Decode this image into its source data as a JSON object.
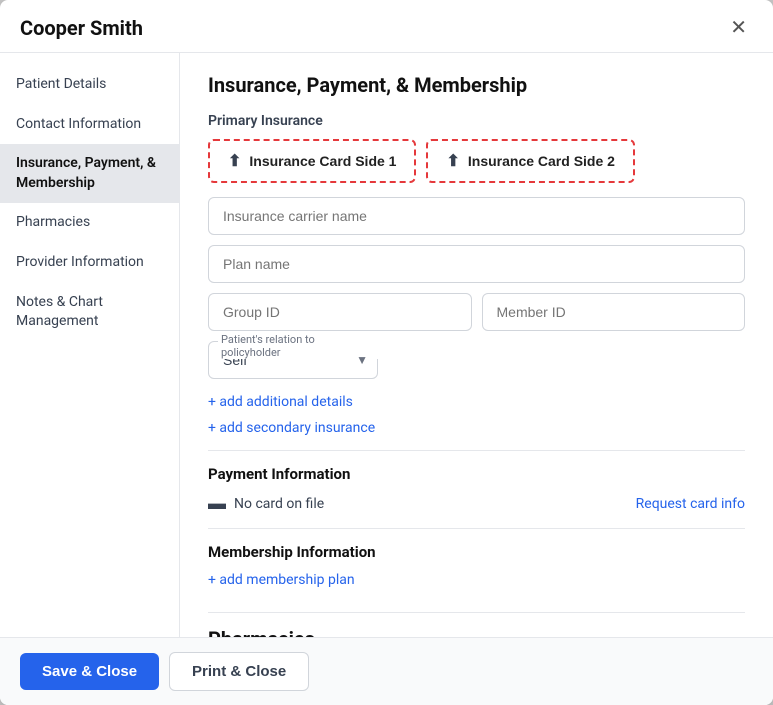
{
  "modal": {
    "title": "Cooper Smith",
    "close_label": "✕"
  },
  "sidebar": {
    "items": [
      {
        "id": "patient-details",
        "label": "Patient Details",
        "active": false
      },
      {
        "id": "contact-information",
        "label": "Contact Information",
        "active": false
      },
      {
        "id": "insurance-payment-membership",
        "label": "Insurance, Payment, & Membership",
        "active": true
      },
      {
        "id": "pharmacies",
        "label": "Pharmacies",
        "active": false
      },
      {
        "id": "provider-information",
        "label": "Provider Information",
        "active": false
      },
      {
        "id": "notes-chart-management",
        "label": "Notes & Chart Management",
        "active": false
      }
    ]
  },
  "main": {
    "section_title": "Insurance, Payment, & Membership",
    "primary_insurance_label": "Primary Insurance",
    "card_side1_label": "Insurance Card Side 1",
    "card_side2_label": "Insurance Card Side 2",
    "insurance_carrier_placeholder": "Insurance carrier name",
    "plan_name_placeholder": "Plan name",
    "group_id_placeholder": "Group ID",
    "member_id_placeholder": "Member ID",
    "relation_label": "Patient's relation to policyholder",
    "relation_default": "Self",
    "add_details_label": "+ add additional details",
    "add_secondary_label": "+ add secondary insurance",
    "payment_section_title": "Payment Information",
    "no_card_label": "No card on file",
    "request_card_label": "Request card info",
    "membership_section_title": "Membership Information",
    "add_membership_label": "+ add membership plan",
    "pharmacies_title": "Pharmacies"
  },
  "footer": {
    "save_close_label": "Save & Close",
    "print_close_label": "Print & Close"
  }
}
